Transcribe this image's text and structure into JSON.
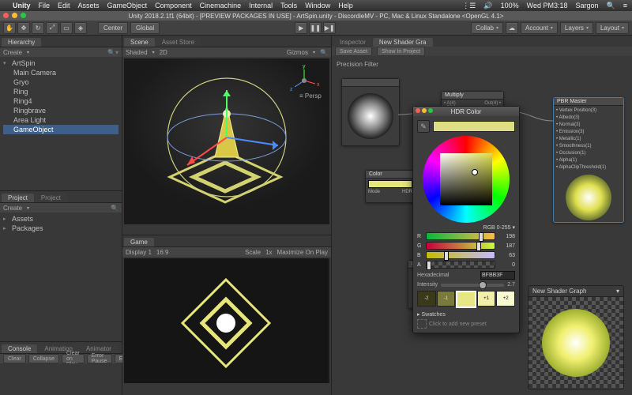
{
  "mac_menu": {
    "app": "Unity",
    "items": [
      "File",
      "Edit",
      "Assets",
      "GameObject",
      "Component",
      "Cinemachine",
      "Internal",
      "Tools",
      "Window",
      "Help"
    ],
    "clock": "Wed PM3:18",
    "user": "Sargon",
    "battery_pct": "100%"
  },
  "window_title": "Unity 2018.2.1f1 (64bit) - [PREVIEW PACKAGES IN USE] - ArtSpin.unity - DiscordieMV - PC, Mac & Linux Standalone <OpenGL 4.1>",
  "toolbar": {
    "pivot": "Center",
    "space": "Global",
    "collab": "Collab",
    "account": "Account",
    "layers": "Layers",
    "layout": "Layout"
  },
  "hierarchy": {
    "tab": "Hierarchy",
    "opts": "Create",
    "scene": "ArtSpin",
    "items": [
      "Main Camera",
      "Gryo",
      "Ring",
      "Ring4",
      "Ringbrave",
      "Area Light",
      "GameObject"
    ],
    "selected": "GameObject"
  },
  "project": {
    "tabs": [
      "Project",
      "Project"
    ],
    "create": "Create",
    "items": [
      "Assets",
      "Packages"
    ]
  },
  "console": {
    "tabs": [
      "Console",
      "Animation",
      "Animator"
    ],
    "buttons": [
      "Clear",
      "Collapse",
      "Clear on Play",
      "Error Pause",
      "Editor"
    ]
  },
  "scene": {
    "tabs": [
      "Scene",
      "Asset Store"
    ],
    "shading": "Shaded",
    "mode": "2D",
    "gizmos": "Gizmos",
    "persp": "Persp"
  },
  "game": {
    "tab": "Game",
    "display": "Display 1",
    "aspect": "16:9",
    "scale_label": "Scale",
    "scale_val": "1x",
    "max": "Maximize On Play"
  },
  "inspector": {
    "tabs": [
      "Inspector",
      "New Shader Gra"
    ],
    "buttons": [
      "Save Asset",
      "Show In Project"
    ]
  },
  "graph": {
    "title": "Precision Filter",
    "blackboard": "New Shader Gra",
    "nodes": {
      "multiply": "Multiply",
      "color": "Color",
      "mode_label": "Mode",
      "mode_val": "HDR"
    },
    "pbr_master": {
      "title": "PBR Master",
      "rows": [
        "Vertex Position(3)",
        "Albedo(3)",
        "Normal(3)",
        "Emission(3)",
        "Metallic(1)",
        "Smoothness(1)",
        "Occlusion(1)",
        "Alpha(1)",
        "AlphaClipThreshold(1)"
      ]
    }
  },
  "preview_card": "New Shader Graph",
  "hdr": {
    "title": "HDR Color",
    "mode_label": "RGB 0-255 ▾",
    "r": 198,
    "g": 187,
    "b": 63,
    "a": 0,
    "hex_label": "Hexadecimal",
    "hex": "BFBB3F",
    "intensity_label": "Intensity",
    "intensity": 2.7,
    "presets": [
      "-2",
      "-1",
      "",
      "+1",
      "+2"
    ],
    "swatches_label": "Swatches",
    "swatches_hint": "Click to add new preset"
  }
}
